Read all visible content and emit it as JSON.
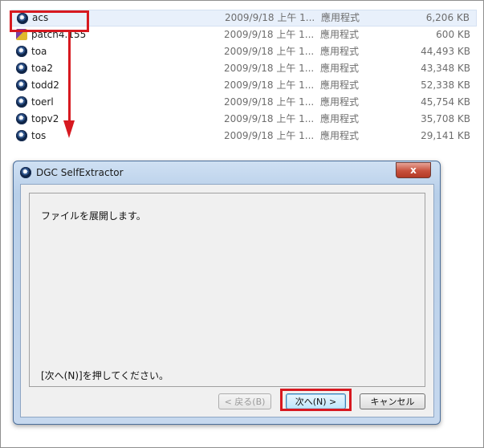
{
  "files": [
    {
      "name": "acs",
      "date": "2009/9/18 上午 1...",
      "type": "應用程式",
      "size": "6,206 KB",
      "icon": "app-icon"
    },
    {
      "name": "patch4.155",
      "date": "2009/9/18 上午 1...",
      "type": "應用程式",
      "size": "600 KB",
      "icon": "patch-icon"
    },
    {
      "name": "toa",
      "date": "2009/9/18 上午 1...",
      "type": "應用程式",
      "size": "44,493 KB",
      "icon": "app-icon"
    },
    {
      "name": "toa2",
      "date": "2009/9/18 上午 1...",
      "type": "應用程式",
      "size": "43,348 KB",
      "icon": "app-icon"
    },
    {
      "name": "todd2",
      "date": "2009/9/18 上午 1...",
      "type": "應用程式",
      "size": "52,338 KB",
      "icon": "app-icon"
    },
    {
      "name": "toerl",
      "date": "2009/9/18 上午 1...",
      "type": "應用程式",
      "size": "45,754 KB",
      "icon": "app-icon"
    },
    {
      "name": "topv2",
      "date": "2009/9/18 上午 1...",
      "type": "應用程式",
      "size": "35,708 KB",
      "icon": "app-icon"
    },
    {
      "name": "tos",
      "date": "2009/9/18 上午 1...",
      "type": "應用程式",
      "size": "29,141 KB",
      "icon": "app-icon"
    }
  ],
  "dialog": {
    "title": "DGC SelfExtractor",
    "close_label": "x",
    "message_top": "ファイルを展開します。",
    "message_bottom": "[次へ(N)]を押してください。",
    "back_label": "< 戻る(B)",
    "next_label": "次へ(N) >",
    "cancel_label": "キャンセル"
  },
  "colors": {
    "highlight": "#d71920",
    "selected_row": "#e8f0fb",
    "dialog_frame": "#b8cfe9"
  }
}
